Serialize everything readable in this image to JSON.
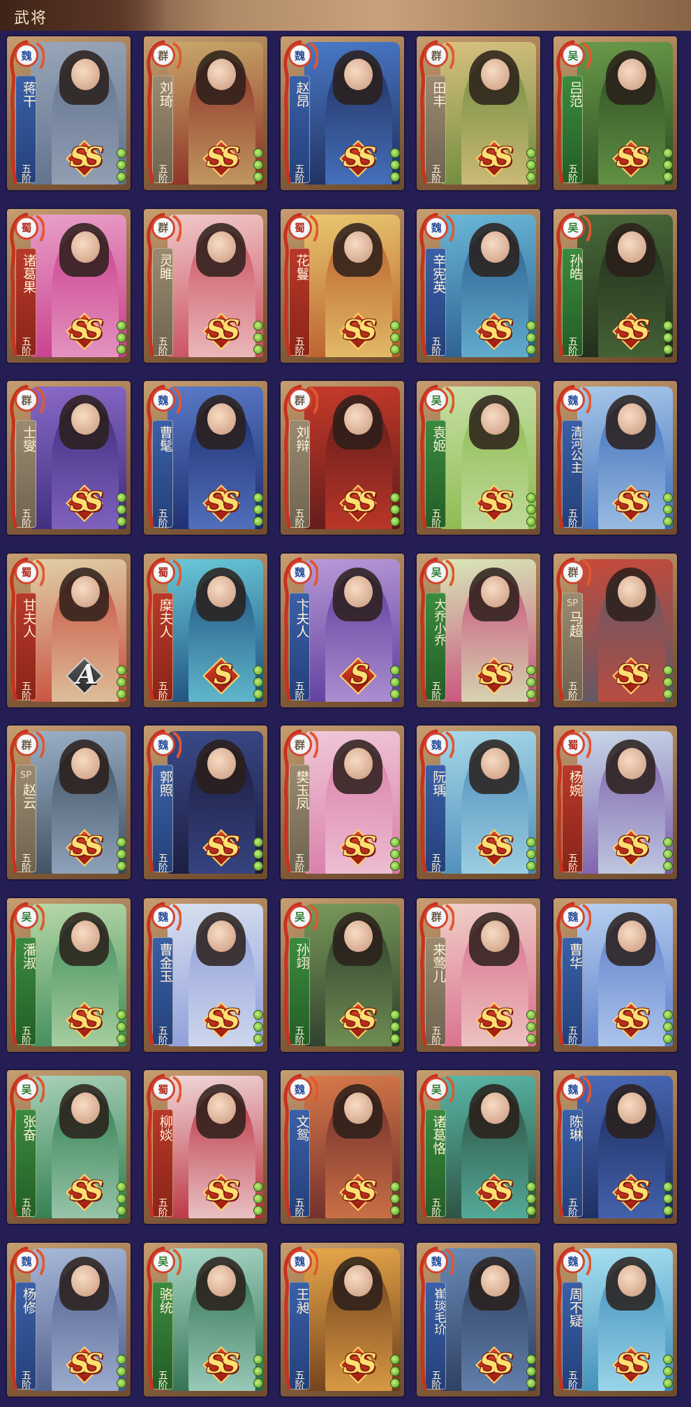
{
  "header": {
    "title": "武将"
  },
  "colors": {
    "shu": "#b8392a",
    "wei": "#3a60a8",
    "wu": "#3b8a3f",
    "qun": "#9a8a70",
    "background": "#241e55",
    "rank_gold": "#ffde72"
  },
  "faction_glyphs": {
    "shu": "蜀",
    "wei": "魏",
    "wu": "吴",
    "qun": "群"
  },
  "cards": [
    {
      "name": "蒋干",
      "sp": "",
      "faction": "wei",
      "tier": "五阶",
      "rank": "SS",
      "pips": 3,
      "palette": [
        "#9aa6b8",
        "#5d6f8c"
      ]
    },
    {
      "name": "刘琦",
      "sp": "",
      "faction": "qun",
      "tier": "五阶",
      "rank": "SS",
      "pips": 3,
      "palette": [
        "#c8a86a",
        "#8a2a22"
      ]
    },
    {
      "name": "赵昂",
      "sp": "",
      "faction": "wei",
      "tier": "五阶",
      "rank": "SS",
      "pips": 3,
      "palette": [
        "#4a7ac8",
        "#1e2c5a"
      ]
    },
    {
      "name": "田丰",
      "sp": "",
      "faction": "qun",
      "tier": "五阶",
      "rank": "SS",
      "pips": 3,
      "palette": [
        "#d9c080",
        "#6a8a3a"
      ]
    },
    {
      "name": "吕范",
      "sp": "",
      "faction": "wu",
      "tier": "五阶",
      "rank": "SS",
      "pips": 3,
      "palette": [
        "#6a9a4a",
        "#2a4a20"
      ]
    },
    {
      "name": "诸葛果",
      "sp": "",
      "faction": "shu",
      "tier": "五阶",
      "rank": "SS",
      "pips": 3,
      "palette": [
        "#e8a0c8",
        "#c83a8a"
      ]
    },
    {
      "name": "灵雎",
      "sp": "",
      "faction": "qun",
      "tier": "五阶",
      "rank": "SS",
      "pips": 3,
      "palette": [
        "#f0c8c8",
        "#c84a5a"
      ]
    },
    {
      "name": "花鬘",
      "sp": "",
      "faction": "shu",
      "tier": "五阶",
      "rank": "SS",
      "pips": 3,
      "palette": [
        "#e8c870",
        "#b85a2a"
      ]
    },
    {
      "name": "辛宪英",
      "sp": "",
      "faction": "wei",
      "tier": "五阶",
      "rank": "SS",
      "pips": 3,
      "palette": [
        "#6ab8d8",
        "#2a5a8a"
      ]
    },
    {
      "name": "孙皓",
      "sp": "",
      "faction": "wu",
      "tier": "五阶",
      "rank": "SS",
      "pips": 3,
      "palette": [
        "#4a6a3a",
        "#1e2a1a"
      ]
    },
    {
      "name": "士燮",
      "sp": "",
      "faction": "qun",
      "tier": "五阶",
      "rank": "SS",
      "pips": 3,
      "palette": [
        "#8a6ac8",
        "#3a2a7a"
      ]
    },
    {
      "name": "曹髦",
      "sp": "",
      "faction": "wei",
      "tier": "五阶",
      "rank": "SS",
      "pips": 3,
      "palette": [
        "#5a7ac8",
        "#1a2a6a"
      ]
    },
    {
      "name": "刘辩",
      "sp": "",
      "faction": "qun",
      "tier": "五阶",
      "rank": "SS",
      "pips": 3,
      "palette": [
        "#c83a2a",
        "#5a1a1a"
      ]
    },
    {
      "name": "袁姬",
      "sp": "",
      "faction": "wu",
      "tier": "五阶",
      "rank": "SS",
      "pips": 3,
      "palette": [
        "#c8e0a8",
        "#8ab84a"
      ]
    },
    {
      "name": "清河公主",
      "sp": "",
      "faction": "wei",
      "tier": "五阶",
      "rank": "SS",
      "pips": 3,
      "palette": [
        "#a8c8e8",
        "#3a6ab8"
      ]
    },
    {
      "name": "甘夫人",
      "sp": "",
      "faction": "shu",
      "tier": "五阶",
      "rank": "A",
      "pips": 3,
      "palette": [
        "#e0d0a8",
        "#c84a3a"
      ]
    },
    {
      "name": "糜夫人",
      "sp": "",
      "faction": "shu",
      "tier": "五阶",
      "rank": "S",
      "pips": 3,
      "palette": [
        "#6ac8d8",
        "#1a4a7a"
      ]
    },
    {
      "name": "卞夫人",
      "sp": "",
      "faction": "wei",
      "tier": "五阶",
      "rank": "S",
      "pips": 3,
      "palette": [
        "#b89ad8",
        "#5a3a9a"
      ]
    },
    {
      "name": "大乔小乔",
      "sp": "",
      "faction": "wu",
      "tier": "五阶",
      "rank": "SS",
      "pips": 3,
      "palette": [
        "#d8e8b8",
        "#c84a7a"
      ]
    },
    {
      "name": "马超",
      "sp": "SP",
      "faction": "qun",
      "tier": "五阶",
      "rank": "SS",
      "pips": 3,
      "palette": [
        "#c84a3a",
        "#5a5a6a"
      ]
    },
    {
      "name": "赵云",
      "sp": "SP",
      "faction": "qun",
      "tier": "五阶",
      "rank": "SS",
      "pips": 3,
      "palette": [
        "#9ab0c8",
        "#3a4a5a"
      ]
    },
    {
      "name": "郭照",
      "sp": "",
      "faction": "wei",
      "tier": "五阶",
      "rank": "SS",
      "pips": 3,
      "palette": [
        "#3a4a8a",
        "#1a1a3a"
      ]
    },
    {
      "name": "樊玉凤",
      "sp": "",
      "faction": "qun",
      "tier": "五阶",
      "rank": "SS",
      "pips": 3,
      "palette": [
        "#f0c8d8",
        "#d87aa8"
      ]
    },
    {
      "name": "阮瑀",
      "sp": "",
      "faction": "wei",
      "tier": "五阶",
      "rank": "SS",
      "pips": 3,
      "palette": [
        "#a8d8e8",
        "#4a8ab8"
      ]
    },
    {
      "name": "杨婉",
      "sp": "",
      "faction": "shu",
      "tier": "五阶",
      "rank": "SS",
      "pips": 3,
      "palette": [
        "#c8d8e8",
        "#7a5aa8"
      ]
    },
    {
      "name": "潘淑",
      "sp": "",
      "faction": "wu",
      "tier": "五阶",
      "rank": "SS",
      "pips": 3,
      "palette": [
        "#b8d8a8",
        "#3a8a5a"
      ]
    },
    {
      "name": "曹金玉",
      "sp": "",
      "faction": "wei",
      "tier": "五阶",
      "rank": "SS",
      "pips": 3,
      "palette": [
        "#d8e0f0",
        "#8a9ad8"
      ]
    },
    {
      "name": "孙翊",
      "sp": "",
      "faction": "wu",
      "tier": "五阶",
      "rank": "SS",
      "pips": 3,
      "palette": [
        "#7a9a5a",
        "#2a3a2a"
      ]
    },
    {
      "name": "来莺儿",
      "sp": "",
      "faction": "qun",
      "tier": "五阶",
      "rank": "SS",
      "pips": 3,
      "palette": [
        "#f0d0c8",
        "#d86a8a"
      ]
    },
    {
      "name": "曹华",
      "sp": "",
      "faction": "wei",
      "tier": "五阶",
      "rank": "SS",
      "pips": 3,
      "palette": [
        "#b8d0f0",
        "#5a7ac8"
      ]
    },
    {
      "name": "张奋",
      "sp": "",
      "faction": "wu",
      "tier": "五阶",
      "rank": "SS",
      "pips": 3,
      "palette": [
        "#a8d0b8",
        "#2a7a4a"
      ]
    },
    {
      "name": "柳婒",
      "sp": "",
      "faction": "shu",
      "tier": "五阶",
      "rank": "SS",
      "pips": 3,
      "palette": [
        "#f0d8d8",
        "#b82a3a"
      ]
    },
    {
      "name": "文鸳",
      "sp": "",
      "faction": "wei",
      "tier": "五阶",
      "rank": "SS",
      "pips": 3,
      "palette": [
        "#d87a4a",
        "#6a2a2a"
      ]
    },
    {
      "name": "诸葛恪",
      "sp": "",
      "faction": "wu",
      "tier": "五阶",
      "rank": "SS",
      "pips": 3,
      "palette": [
        "#5ab8a8",
        "#2a4a3a"
      ]
    },
    {
      "name": "陈琳",
      "sp": "",
      "faction": "wei",
      "tier": "五阶",
      "rank": "SS",
      "pips": 3,
      "palette": [
        "#4a6ab8",
        "#1a2a5a"
      ]
    },
    {
      "name": "杨修",
      "sp": "",
      "faction": "wei",
      "tier": "五阶",
      "rank": "SS",
      "pips": 3,
      "palette": [
        "#a8b8d8",
        "#4a5a8a"
      ]
    },
    {
      "name": "骆统",
      "sp": "",
      "faction": "wu",
      "tier": "五阶",
      "rank": "SS",
      "pips": 3,
      "palette": [
        "#a8d8c8",
        "#2a6a4a"
      ]
    },
    {
      "name": "王昶",
      "sp": "",
      "faction": "wei",
      "tier": "五阶",
      "rank": "SS",
      "pips": 3,
      "palette": [
        "#e8a84a",
        "#6a3a1a"
      ]
    },
    {
      "name": "崔琰毛玠",
      "sp": "",
      "faction": "wei",
      "tier": "五阶",
      "rank": "SS",
      "pips": 3,
      "palette": [
        "#6a8ab8",
        "#2a3a5a"
      ]
    },
    {
      "name": "周不疑",
      "sp": "",
      "faction": "wei",
      "tier": "五阶",
      "rank": "SS",
      "pips": 3,
      "palette": [
        "#a8e0f0",
        "#3a8ab8"
      ]
    }
  ]
}
